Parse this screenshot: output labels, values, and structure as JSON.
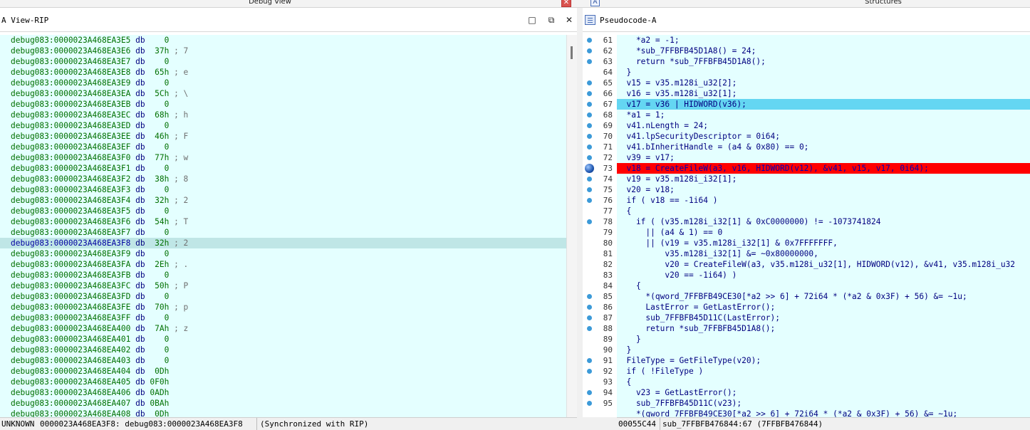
{
  "topbar": {
    "debug_view_title": "Debug View",
    "structures_title": "Structures",
    "close_glyph": "✕",
    "structures_icon_glyph": "A"
  },
  "left": {
    "title": "A View-RIP",
    "buttons": {
      "maximize": "□",
      "restore": "⧉",
      "close": "✕"
    },
    "rows": [
      {
        "addr": "debug083:0000023A468EA3E5",
        "op": "db",
        "val": "   0",
        "cmt": ""
      },
      {
        "addr": "debug083:0000023A468EA3E6",
        "op": "db",
        "val": " 37h",
        "cmt": " ; 7"
      },
      {
        "addr": "debug083:0000023A468EA3E7",
        "op": "db",
        "val": "   0",
        "cmt": ""
      },
      {
        "addr": "debug083:0000023A468EA3E8",
        "op": "db",
        "val": " 65h",
        "cmt": " ; e"
      },
      {
        "addr": "debug083:0000023A468EA3E9",
        "op": "db",
        "val": "   0",
        "cmt": ""
      },
      {
        "addr": "debug083:0000023A468EA3EA",
        "op": "db",
        "val": " 5Ch",
        "cmt": " ; \\"
      },
      {
        "addr": "debug083:0000023A468EA3EB",
        "op": "db",
        "val": "   0",
        "cmt": ""
      },
      {
        "addr": "debug083:0000023A468EA3EC",
        "op": "db",
        "val": " 68h",
        "cmt": " ; h"
      },
      {
        "addr": "debug083:0000023A468EA3ED",
        "op": "db",
        "val": "   0",
        "cmt": ""
      },
      {
        "addr": "debug083:0000023A468EA3EE",
        "op": "db",
        "val": " 46h",
        "cmt": " ; F"
      },
      {
        "addr": "debug083:0000023A468EA3EF",
        "op": "db",
        "val": "   0",
        "cmt": ""
      },
      {
        "addr": "debug083:0000023A468EA3F0",
        "op": "db",
        "val": " 77h",
        "cmt": " ; w"
      },
      {
        "addr": "debug083:0000023A468EA3F1",
        "op": "db",
        "val": "   0",
        "cmt": ""
      },
      {
        "addr": "debug083:0000023A468EA3F2",
        "op": "db",
        "val": " 38h",
        "cmt": " ; 8"
      },
      {
        "addr": "debug083:0000023A468EA3F3",
        "op": "db",
        "val": "   0",
        "cmt": ""
      },
      {
        "addr": "debug083:0000023A468EA3F4",
        "op": "db",
        "val": " 32h",
        "cmt": " ; 2"
      },
      {
        "addr": "debug083:0000023A468EA3F5",
        "op": "db",
        "val": "   0",
        "cmt": ""
      },
      {
        "addr": "debug083:0000023A468EA3F6",
        "op": "db",
        "val": " 54h",
        "cmt": " ; T"
      },
      {
        "addr": "debug083:0000023A468EA3F7",
        "op": "db",
        "val": "   0",
        "cmt": ""
      },
      {
        "addr": "debug083:0000023A468EA3F8",
        "op": "db",
        "val": " 32h",
        "cmt": " ; 2",
        "highlight": true
      },
      {
        "addr": "debug083:0000023A468EA3F9",
        "op": "db",
        "val": "   0",
        "cmt": ""
      },
      {
        "addr": "debug083:0000023A468EA3FA",
        "op": "db",
        "val": " 2Eh",
        "cmt": " ; ."
      },
      {
        "addr": "debug083:0000023A468EA3FB",
        "op": "db",
        "val": "   0",
        "cmt": ""
      },
      {
        "addr": "debug083:0000023A468EA3FC",
        "op": "db",
        "val": " 50h",
        "cmt": " ; P"
      },
      {
        "addr": "debug083:0000023A468EA3FD",
        "op": "db",
        "val": "   0",
        "cmt": ""
      },
      {
        "addr": "debug083:0000023A468EA3FE",
        "op": "db",
        "val": " 70h",
        "cmt": " ; p"
      },
      {
        "addr": "debug083:0000023A468EA3FF",
        "op": "db",
        "val": "   0",
        "cmt": ""
      },
      {
        "addr": "debug083:0000023A468EA400",
        "op": "db",
        "val": " 7Ah",
        "cmt": " ; z"
      },
      {
        "addr": "debug083:0000023A468EA401",
        "op": "db",
        "val": "   0",
        "cmt": ""
      },
      {
        "addr": "debug083:0000023A468EA402",
        "op": "db",
        "val": "   0",
        "cmt": ""
      },
      {
        "addr": "debug083:0000023A468EA403",
        "op": "db",
        "val": "   0",
        "cmt": ""
      },
      {
        "addr": "debug083:0000023A468EA404",
        "op": "db",
        "val": " 0Dh",
        "cmt": ""
      },
      {
        "addr": "debug083:0000023A468EA405",
        "op": "db",
        "val": "0F0h",
        "cmt": ""
      },
      {
        "addr": "debug083:0000023A468EA406",
        "op": "db",
        "val": "0ADh",
        "cmt": ""
      },
      {
        "addr": "debug083:0000023A468EA407",
        "op": "db",
        "val": "0BAh",
        "cmt": ""
      },
      {
        "addr": "debug083:0000023A468EA408",
        "op": "db",
        "val": " 0Dh",
        "cmt": ""
      }
    ],
    "status": {
      "kind": "UNKNOWN",
      "location": "0000023A468EA3F8: debug083:0000023A468EA3F8",
      "sync": "(Synchronized with RIP)"
    }
  },
  "right": {
    "title": "Pseudocode-A",
    "lines": [
      {
        "n": "61",
        "dot": true,
        "text": "    *a2 = -1;"
      },
      {
        "n": "62",
        "dot": true,
        "text": "    *sub_7FFBFB45D1A8() = 24;"
      },
      {
        "n": "63",
        "dot": true,
        "text": "    return *sub_7FFBFB45D1A8();"
      },
      {
        "n": "64",
        "dot": false,
        "text": "  }"
      },
      {
        "n": "65",
        "dot": true,
        "text": "  v15 = v35.m128i_u32[2];"
      },
      {
        "n": "66",
        "dot": true,
        "text": "  v16 = v35.m128i_u32[1];"
      },
      {
        "n": "67",
        "dot": true,
        "text": "  v17 = v36 | HIDWORD(v36);",
        "state": "sel"
      },
      {
        "n": "68",
        "dot": true,
        "text": "  *a1 = 1;"
      },
      {
        "n": "69",
        "dot": true,
        "text": "  v41.nLength = 24;"
      },
      {
        "n": "70",
        "dot": true,
        "text": "  v41.lpSecurityDescriptor = 0i64;"
      },
      {
        "n": "71",
        "dot": true,
        "text": "  v41.bInheritHandle = (a4 & 0x80) == 0;"
      },
      {
        "n": "72",
        "dot": true,
        "text": "  v39 = v17;"
      },
      {
        "n": "73",
        "dot": false,
        "bp": true,
        "text": "  v18 = CreateFileW(a3, v16, HIDWORD(v12), &v41, v15, v17, 0i64);",
        "state": "bp"
      },
      {
        "n": "74",
        "dot": true,
        "text": "  v19 = v35.m128i_i32[1];"
      },
      {
        "n": "75",
        "dot": true,
        "text": "  v20 = v18;"
      },
      {
        "n": "76",
        "dot": true,
        "text": "  if ( v18 == -1i64 )"
      },
      {
        "n": "77",
        "dot": false,
        "text": "  {"
      },
      {
        "n": "78",
        "dot": true,
        "text": "    if ( (v35.m128i_i32[1] & 0xC0000000) != -1073741824"
      },
      {
        "n": "79",
        "dot": false,
        "text": "      || (a4 & 1) == 0"
      },
      {
        "n": "80",
        "dot": false,
        "text": "      || (v19 = v35.m128i_i32[1] & 0x7FFFFFFF,"
      },
      {
        "n": "81",
        "dot": false,
        "text": "          v35.m128i_i32[1] &= ~0x80000000,"
      },
      {
        "n": "82",
        "dot": false,
        "text": "          v20 = CreateFileW(a3, v35.m128i_u32[1], HIDWORD(v12), &v41, v35.m128i_u32"
      },
      {
        "n": "83",
        "dot": false,
        "text": "          v20 == -1i64) )"
      },
      {
        "n": "84",
        "dot": false,
        "text": "    {"
      },
      {
        "n": "85",
        "dot": true,
        "text": "      *(qword_7FFBFB49CE30[*a2 >> 6] + 72i64 * (*a2 & 0x3F) + 56) &= ~1u;"
      },
      {
        "n": "86",
        "dot": true,
        "text": "      LastError = GetLastError();"
      },
      {
        "n": "87",
        "dot": true,
        "text": "      sub_7FFBFB45D11C(LastError);"
      },
      {
        "n": "88",
        "dot": true,
        "text": "      return *sub_7FFBFB45D1A8();"
      },
      {
        "n": "89",
        "dot": false,
        "text": "    }"
      },
      {
        "n": "90",
        "dot": false,
        "text": "  }"
      },
      {
        "n": "91",
        "dot": true,
        "text": "  FileType = GetFileType(v20);"
      },
      {
        "n": "92",
        "dot": true,
        "text": "  if ( !FileType )"
      },
      {
        "n": "93",
        "dot": false,
        "text": "  {"
      },
      {
        "n": "94",
        "dot": true,
        "text": "    v23 = GetLastError();"
      },
      {
        "n": "95",
        "dot": true,
        "text": "    sub_7FFBFB45D11C(v23);"
      },
      {
        "n": "",
        "dot": false,
        "text": "    *(qword_7FFBFB49CE30[*a2 >> 6] + 72i64 * (*a2 & 0x3F) + 56) &= ~1u;"
      }
    ],
    "status": {
      "offset": "00055C44",
      "location": "sub_7FFBFB476844:67 (7FFBFB476844)"
    }
  }
}
